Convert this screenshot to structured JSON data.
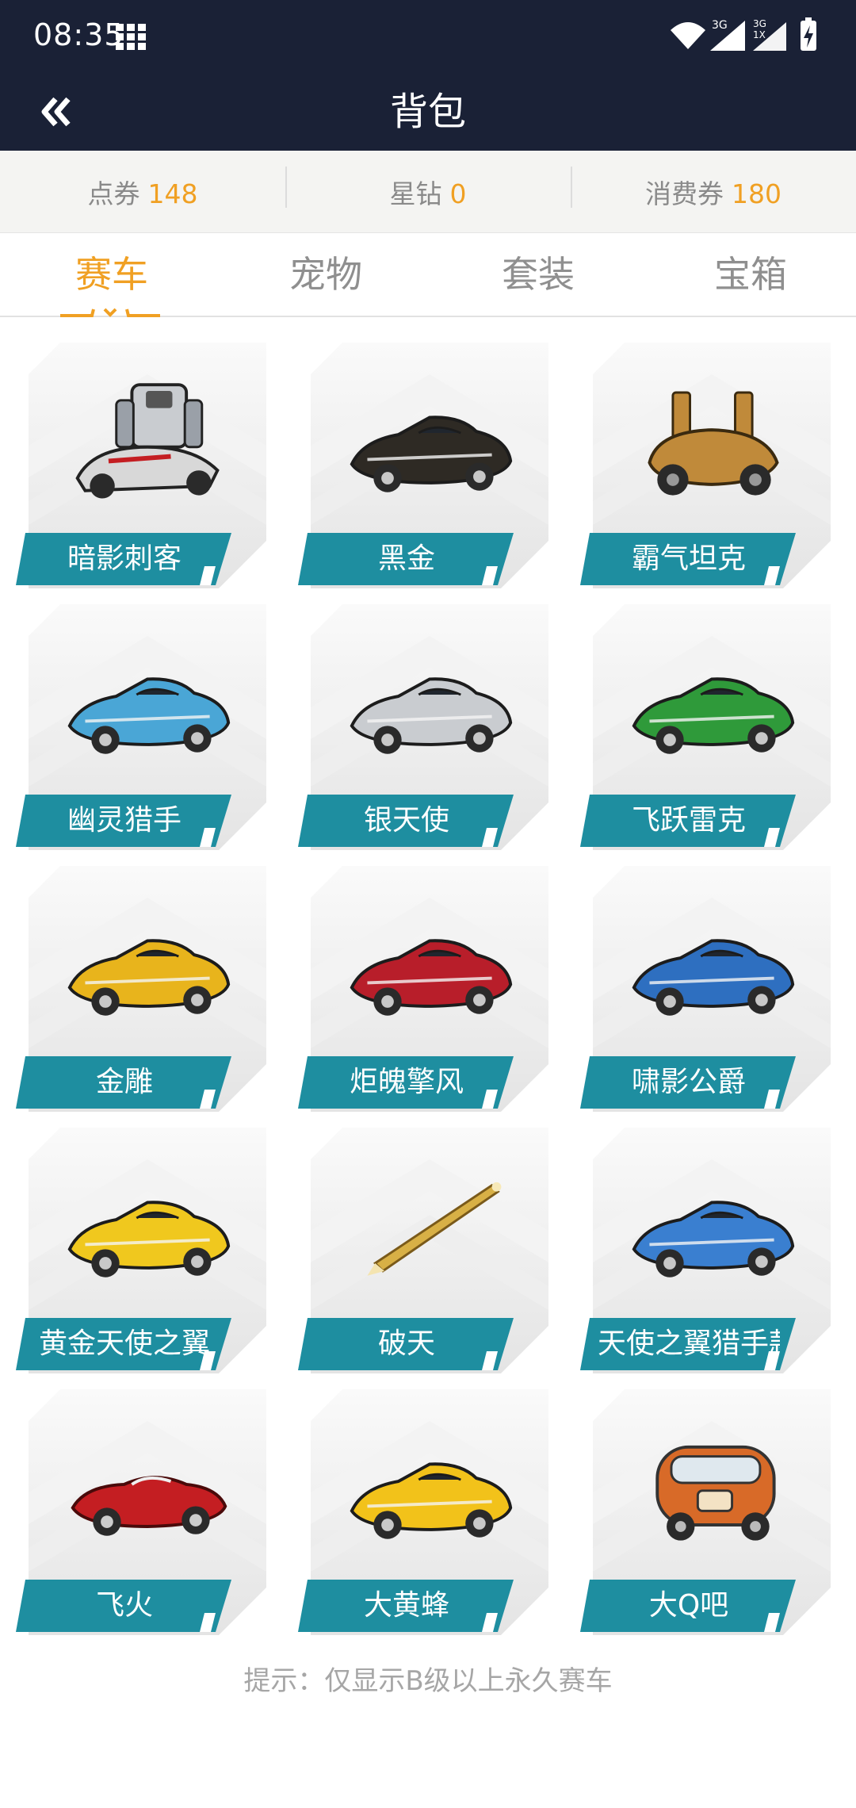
{
  "status": {
    "time": "08:35",
    "signal1": "3G",
    "signal2_top": "3G",
    "signal2_bottom": "1X"
  },
  "header": {
    "title": "背包",
    "back_icon": "double-chevron-left-icon"
  },
  "balances": [
    {
      "label": "点券",
      "value": "148"
    },
    {
      "label": "星钻",
      "value": "0"
    },
    {
      "label": "消费券",
      "value": "180"
    }
  ],
  "tabs": [
    {
      "label": "赛车",
      "active": true
    },
    {
      "label": "宠物",
      "active": false
    },
    {
      "label": "套装",
      "active": false
    },
    {
      "label": "宝箱",
      "active": false
    }
  ],
  "items": [
    {
      "name": "暗影刺客",
      "icon": "robot-car-icon",
      "color": "#9aa0a8"
    },
    {
      "name": "黑金",
      "icon": "sports-car-icon",
      "color": "#2e2a24"
    },
    {
      "name": "霸气坦克",
      "icon": "tank-car-icon",
      "color": "#c08a3a"
    },
    {
      "name": "幽灵猎手",
      "icon": "sports-car-icon",
      "color": "#4aa6d6"
    },
    {
      "name": "银天使",
      "icon": "sports-car-icon",
      "color": "#c9ccd0"
    },
    {
      "name": "飞跃雷克",
      "icon": "sports-car-icon",
      "color": "#2f9a3a"
    },
    {
      "name": "金雕",
      "icon": "sports-car-icon",
      "color": "#e8b41c"
    },
    {
      "name": "炬魄擎风",
      "icon": "sports-car-icon",
      "color": "#b81e2a"
    },
    {
      "name": "啸影公爵",
      "icon": "sports-car-icon",
      "color": "#2e6fc0"
    },
    {
      "name": "黄金天使之翼",
      "icon": "sports-car-icon",
      "color": "#f0c81e"
    },
    {
      "name": "破天",
      "icon": "sword-icon",
      "color": "#d8b046"
    },
    {
      "name": "天使之翼猎手款",
      "icon": "sports-car-icon",
      "color": "#3a7fd0"
    },
    {
      "name": "飞火",
      "icon": "convertible-car-icon",
      "color": "#c41e22"
    },
    {
      "name": "大黄蜂",
      "icon": "sports-car-icon",
      "color": "#f2c21a"
    },
    {
      "name": "大Q吧",
      "icon": "van-car-icon",
      "color": "#d86a28"
    }
  ],
  "hint": "提示：仅显示B级以上永久赛车",
  "colors": {
    "accent": "#f0a023",
    "header_bg": "#1a2136",
    "label_bg": "#1e8ea0"
  }
}
